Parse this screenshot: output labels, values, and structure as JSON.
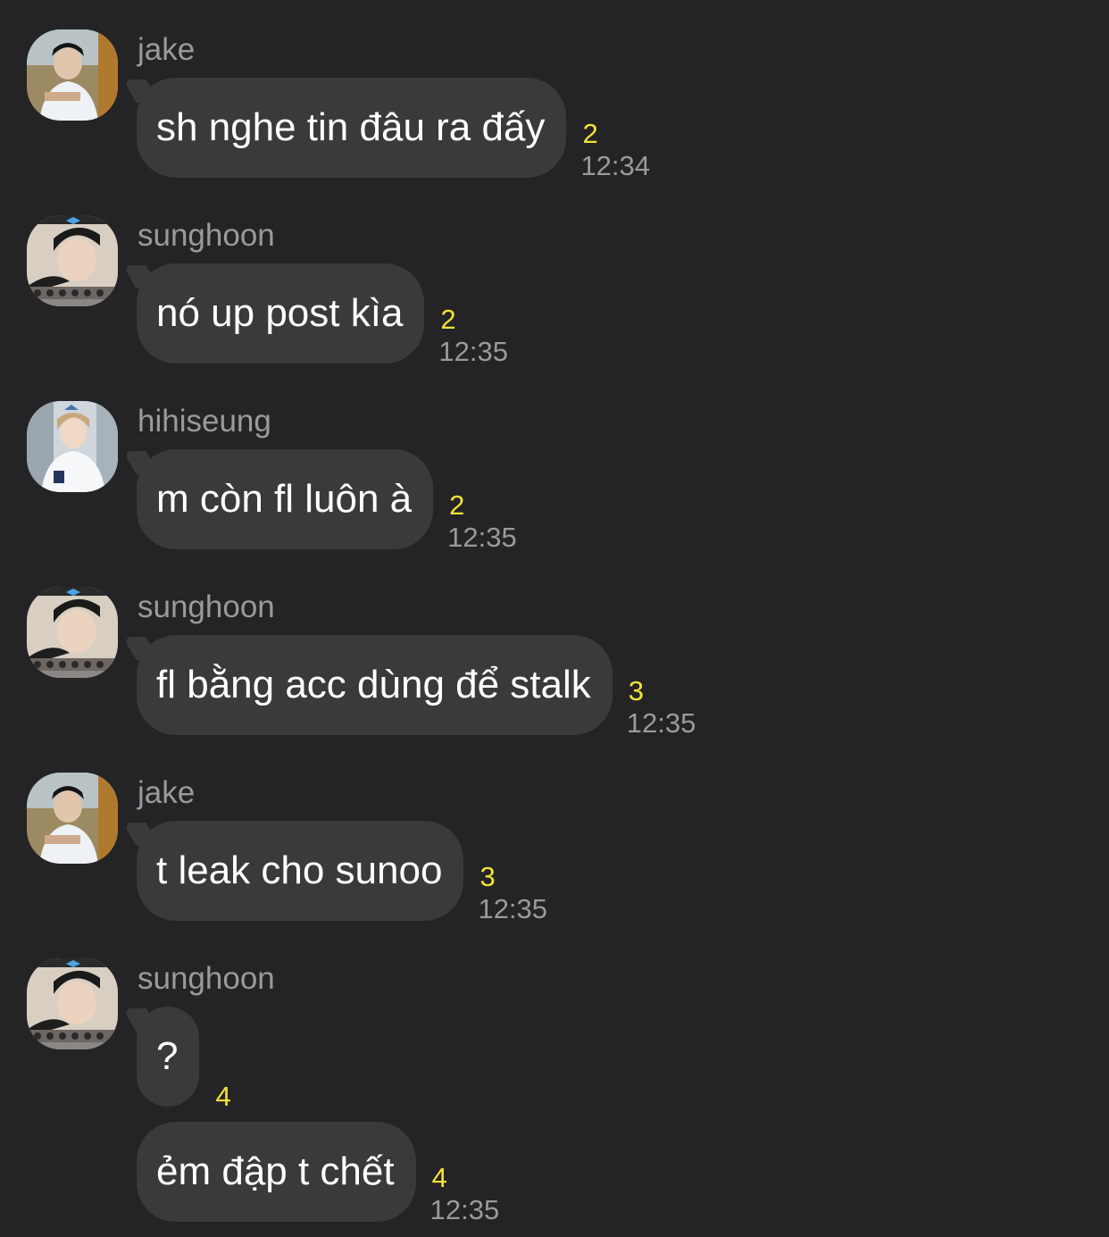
{
  "messages": [
    {
      "sender": "jake",
      "text": "sh nghe tin đâu ra đấy",
      "unread": "2",
      "time": "12:34",
      "avatar": "jake-avatar"
    },
    {
      "sender": "sunghoon",
      "text": "nó up post kìa",
      "unread": "2",
      "time": "12:35",
      "avatar": "sunghoon-avatar"
    },
    {
      "sender": "hihiseung",
      "text": "m còn fl luôn à",
      "unread": "2",
      "time": "12:35",
      "avatar": "hihiseung-avatar"
    },
    {
      "sender": "sunghoon",
      "text": "fl bằng acc dùng để stalk",
      "unread": "3",
      "time": "12:35",
      "avatar": "sunghoon-avatar"
    },
    {
      "sender": "jake",
      "text": "t leak cho sunoo",
      "unread": "3",
      "time": "12:35",
      "avatar": "jake-avatar"
    },
    {
      "sender": "sunghoon",
      "text": "?",
      "unread": "4",
      "time": "",
      "avatar": "sunghoon-avatar"
    },
    {
      "text": "ẻm đập t chết",
      "unread": "4",
      "time": "12:35"
    }
  ],
  "colors": {
    "background": "#242426",
    "bubble": "#3a3a3c",
    "text": "#ffffff",
    "meta": "#9a9a9c",
    "unread": "#f2e13a"
  }
}
